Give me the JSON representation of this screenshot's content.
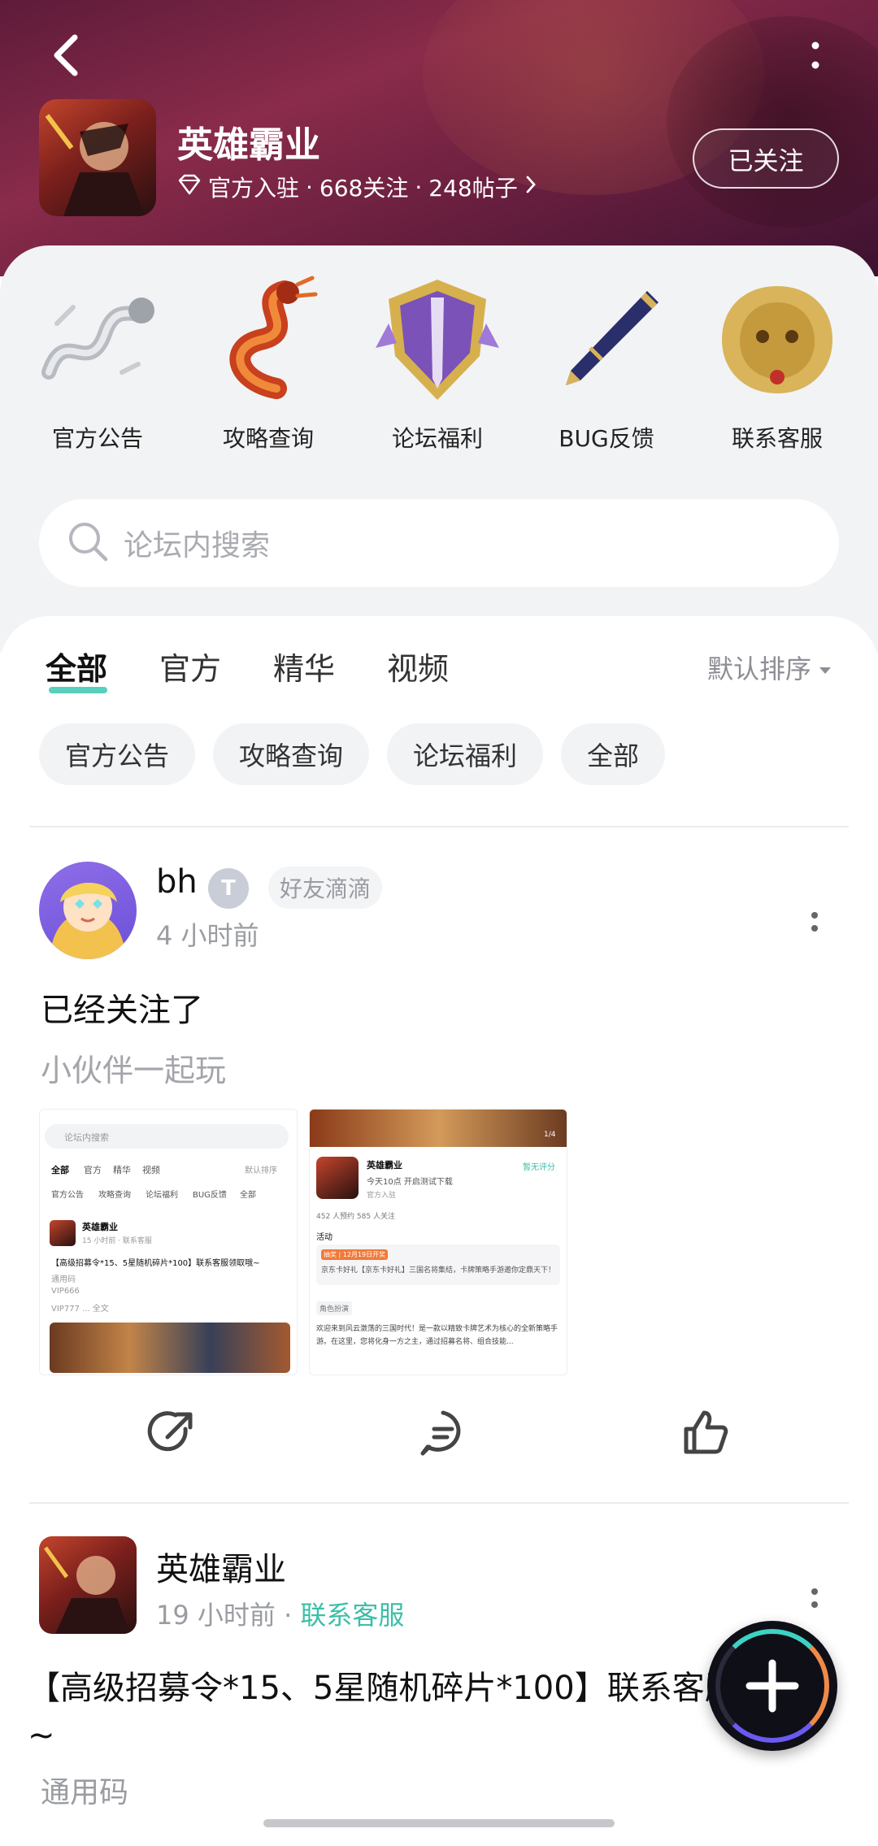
{
  "header": {
    "forum_name": "英雄霸业",
    "verified": "官方入驻",
    "followers": "668关注",
    "posts": "248帖子",
    "follow_state": "已关注"
  },
  "quick_entries": [
    {
      "label": "官方公告",
      "icon": "silver-dragon-icon"
    },
    {
      "label": "攻略查询",
      "icon": "fire-dragon-icon"
    },
    {
      "label": "论坛福利",
      "icon": "purple-emblem-icon"
    },
    {
      "label": "BUG反馈",
      "icon": "pen-icon"
    },
    {
      "label": "联系客服",
      "icon": "golden-lion-icon"
    }
  ],
  "search": {
    "placeholder": "论坛内搜索"
  },
  "tabs": [
    {
      "label": "全部",
      "active": true
    },
    {
      "label": "官方",
      "active": false
    },
    {
      "label": "精华",
      "active": false
    },
    {
      "label": "视频",
      "active": false
    }
  ],
  "sort_label": "默认排序",
  "chips": [
    "官方公告",
    "攻略查询",
    "论坛福利",
    "全部"
  ],
  "post1": {
    "username": "bh",
    "level_badge": "T",
    "tag": "好友滴滴",
    "time": "4 小时前",
    "title": "已经关注了",
    "body": "小伙伴一起玩",
    "shot1": {
      "search": "论坛内搜索",
      "tabs": [
        "全部",
        "官方",
        "精华",
        "视频"
      ],
      "sort": "默认排序",
      "chips": [
        "官方公告",
        "攻略查询",
        "论坛福利",
        "BUG反馈",
        "全部"
      ],
      "author": "英雄霸业",
      "meta": "15 小时前 · 联系客服",
      "headline": "【高级招募令*15、5星随机碎片*100】联系客服领取哦~",
      "line1": "通用码",
      "line2": "VIP666",
      "line3": "VIP777 ... 全文"
    },
    "shot2": {
      "counter": "1/4",
      "name": "英雄霸业",
      "rating": "暂无评分",
      "release": "今天10点 开启测试下载",
      "official": "官方入驻",
      "stats": "452 人预约   585 人关注",
      "activity": "活动",
      "event_tag": "抽奖 | 12月19日开奖",
      "event_text": "京东卡好礼【京东卡好礼】三国名将集结，卡牌策略手游邀你定鼎天下！",
      "section": "角色扮演",
      "desc": "欢迎来到风云激荡的三国时代！是一款以精致卡牌艺术为核心的全新策略手游。在这里，您将化身一方之主，通过招募名将、组合技能..."
    }
  },
  "post2": {
    "username": "英雄霸业",
    "time": "19 小时前",
    "category": "联系客服",
    "title": "【高级招募令*15、5星随机碎片*100】联系客服领取哦~",
    "body": "通用码"
  },
  "colors": {
    "accent": "#3cbfa7",
    "header": "#7a2545"
  }
}
